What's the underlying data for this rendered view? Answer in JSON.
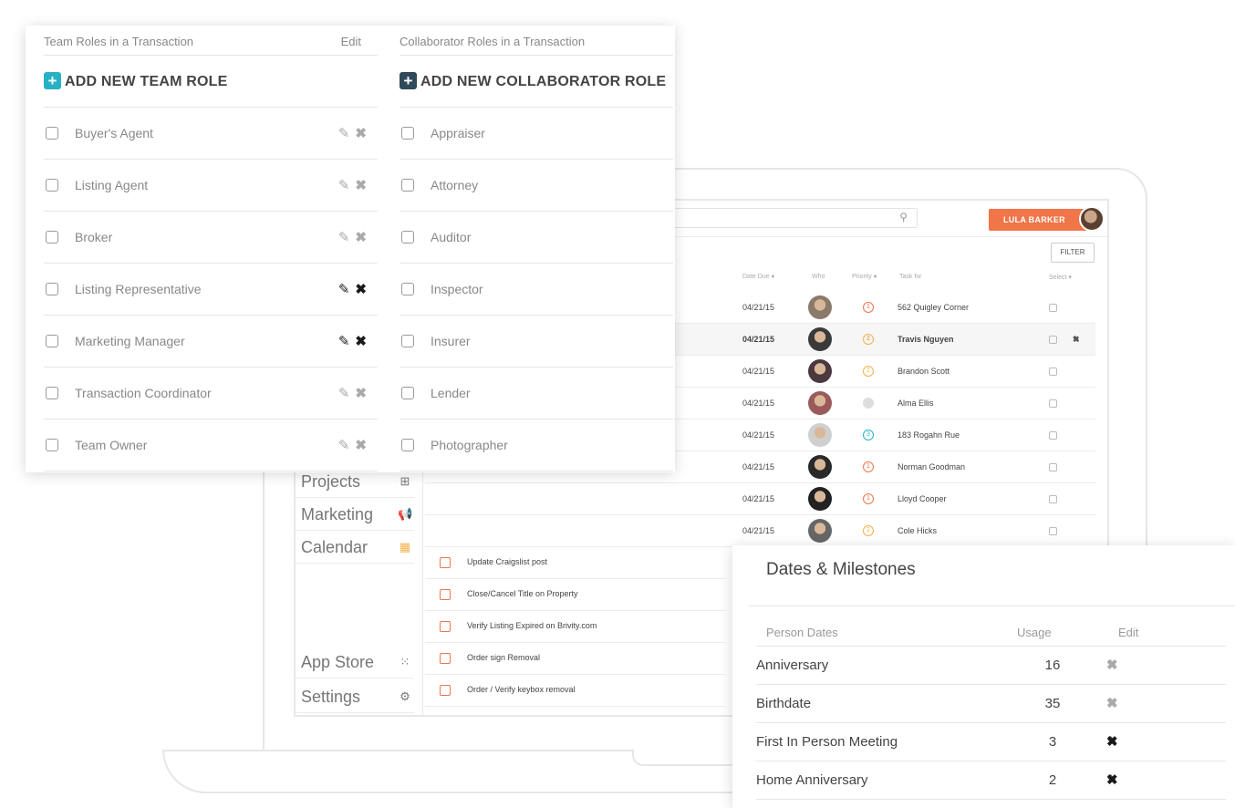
{
  "colors": {
    "accent_orange": "#f07548",
    "accent_teal": "#26b1c5",
    "accent_dark": "#2f4a5a"
  },
  "team_roles": {
    "header": "Team Roles in a Transaction",
    "edit_label": "Edit",
    "add_label": "ADD NEW TEAM ROLE",
    "items": [
      {
        "name": "Buyer's Agent",
        "icons_active": false
      },
      {
        "name": "Listing Agent",
        "icons_active": false
      },
      {
        "name": "Broker",
        "icons_active": false
      },
      {
        "name": "Listing Representative",
        "icons_active": true
      },
      {
        "name": "Marketing Manager",
        "icons_active": true
      },
      {
        "name": "Transaction Coordinator",
        "icons_active": false
      },
      {
        "name": "Team Owner",
        "icons_active": false
      }
    ]
  },
  "collaborator_roles": {
    "header": "Collaborator Roles in a Transaction",
    "add_label": "ADD NEW COLLABORATOR ROLE",
    "items": [
      "Appraiser",
      "Attorney",
      "Auditor",
      "Inspector",
      "Insurer",
      "Lender",
      "Photographer"
    ]
  },
  "app": {
    "user_name": "LULA BARKER",
    "filter_label": "FILTER",
    "columns": {
      "date_due": "Date Due ♦",
      "who": "Who",
      "priority": "Priority ♦",
      "task_for": "Task for",
      "select": "Select ▾"
    },
    "tasks": [
      {
        "date": "04/21/15",
        "priority": "1",
        "priority_color": "#f07548",
        "task_for": "562 Quigley Corner",
        "highlight": false,
        "avatar": "#8a7a6a"
      },
      {
        "date": "04/21/15",
        "priority": "2",
        "priority_color": "#f2b24c",
        "task_for": "Travis Nguyen",
        "highlight": true,
        "avatar": "#3a3a3a"
      },
      {
        "date": "04/21/15",
        "priority": "2",
        "priority_color": "#f2b24c",
        "task_for": "Brandon Scott",
        "highlight": false,
        "avatar": "#4a3a40"
      },
      {
        "date": "04/21/15",
        "priority": "",
        "priority_color": "#dddddd",
        "task_for": "Alma Ellis",
        "highlight": false,
        "avatar": "#9a5a5a"
      },
      {
        "date": "04/21/15",
        "priority": "3",
        "priority_color": "#26b1c5",
        "task_for": "183 Rogahn Rue",
        "highlight": false,
        "avatar": "#cfcfcf"
      },
      {
        "date": "04/21/15",
        "priority": "1",
        "priority_color": "#f07548",
        "task_for": "Norman Goodman",
        "highlight": false,
        "avatar": "#2a2a2a"
      },
      {
        "date": "04/21/15",
        "priority": "1",
        "priority_color": "#f07548",
        "task_for": "Lloyd Cooper",
        "highlight": false,
        "avatar": "#222222"
      },
      {
        "date": "04/21/15",
        "priority": "2",
        "priority_color": "#f2b24c",
        "task_for": "Cole Hicks",
        "highlight": false,
        "avatar": "#666666"
      }
    ],
    "checklist": [
      "Update Craigslist post",
      "Close/Cancel Title on Property",
      "Verify Listing Expired on Brivity.com",
      "Order sign Removal",
      "Order / Verify keybox removal"
    ],
    "nav": [
      {
        "label": "Projects",
        "icon": "plus-box-icon",
        "glyph": "⊞"
      },
      {
        "label": "Marketing",
        "icon": "megaphone-icon",
        "glyph": "📢"
      },
      {
        "label": "Calendar",
        "icon": "calendar-icon",
        "glyph": "▦"
      },
      {
        "label": "App Store",
        "icon": "grid-icon",
        "glyph": "⁙"
      },
      {
        "label": "Settings",
        "icon": "gear-icon",
        "glyph": "⚙"
      }
    ]
  },
  "dates": {
    "title": "Dates & Milestones",
    "col_person": "Person Dates",
    "col_usage": "Usage",
    "col_edit": "Edit",
    "rows": [
      {
        "name": "Anniversary",
        "usage": "16",
        "active": false
      },
      {
        "name": "Birthdate",
        "usage": "35",
        "active": false
      },
      {
        "name": "First In Person Meeting",
        "usage": "3",
        "active": true
      },
      {
        "name": "Home Anniversary",
        "usage": "2",
        "active": true
      }
    ]
  }
}
